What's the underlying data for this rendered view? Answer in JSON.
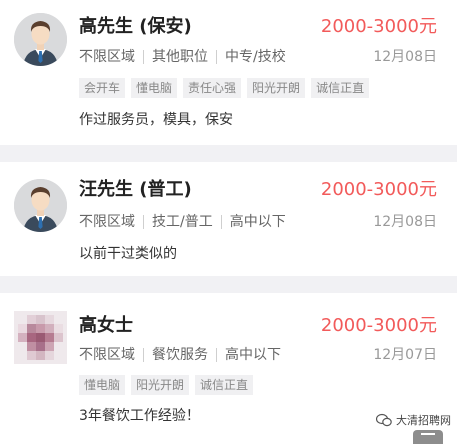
{
  "candidates": [
    {
      "name": "高先生 (保安)",
      "salary": "2000-3000元",
      "meta": [
        "不限区域",
        "其他职位",
        "中专/技校"
      ],
      "date": "12月08日",
      "tags": [
        "会开车",
        "懂电脑",
        "责任心强",
        "阳光开朗",
        "诚信正直"
      ],
      "description": "作过服务员，模具，保安"
    },
    {
      "name": "汪先生 (普工)",
      "salary": "2000-3000元",
      "meta": [
        "不限区域",
        "技工/普工",
        "高中以下"
      ],
      "date": "12月08日",
      "tags": [],
      "description": "以前干过类似的"
    },
    {
      "name": "高女士",
      "salary": "2000-3000元",
      "meta": [
        "不限区域",
        "餐饮服务",
        "高中以下"
      ],
      "date": "12月07日",
      "tags": [
        "懂电脑",
        "阳光开朗",
        "诚信正直"
      ],
      "description": "3年餐饮工作经验！"
    }
  ],
  "watermark": "大清招聘网",
  "colors": {
    "salary": "#f25a5a",
    "tag_bg": "#f0f0f2",
    "page_bg": "#f1f1f4"
  }
}
